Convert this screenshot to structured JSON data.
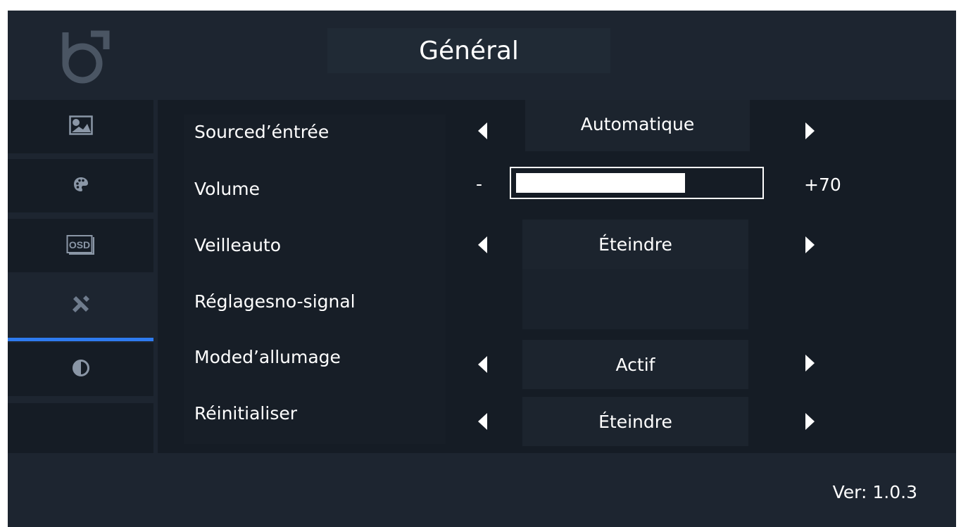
{
  "header": {
    "title": "Général",
    "logo": "b-brand-logo"
  },
  "sidebar": {
    "items": [
      {
        "icon": "picture-icon"
      },
      {
        "icon": "palette-icon"
      },
      {
        "icon": "osd-icon",
        "icon_text": "OSD"
      },
      {
        "icon": "tools-icon",
        "active": true
      },
      {
        "icon": "contrast-icon"
      },
      {
        "icon": "empty"
      }
    ]
  },
  "settings": {
    "input_source": {
      "label": "Sourced’éntrée",
      "value": "Automatique"
    },
    "volume": {
      "label": "Volume",
      "minus": "-",
      "value_text": "+70",
      "level": 0.7
    },
    "auto_sleep": {
      "label": "Veilleauto",
      "value": "Éteindre"
    },
    "no_signal": {
      "label": "Réglagesno-signal"
    },
    "power_mode": {
      "label": "Moded’allumage",
      "value": "Actif"
    },
    "reset": {
      "label": "Réinitialiser",
      "value": "Éteindre"
    }
  },
  "footer": {
    "version": "Ver: 1.0.3"
  },
  "colors": {
    "background": "#1d2530",
    "panel": "#151c25",
    "accent": "#2e7bf0",
    "text": "#ffffff"
  }
}
